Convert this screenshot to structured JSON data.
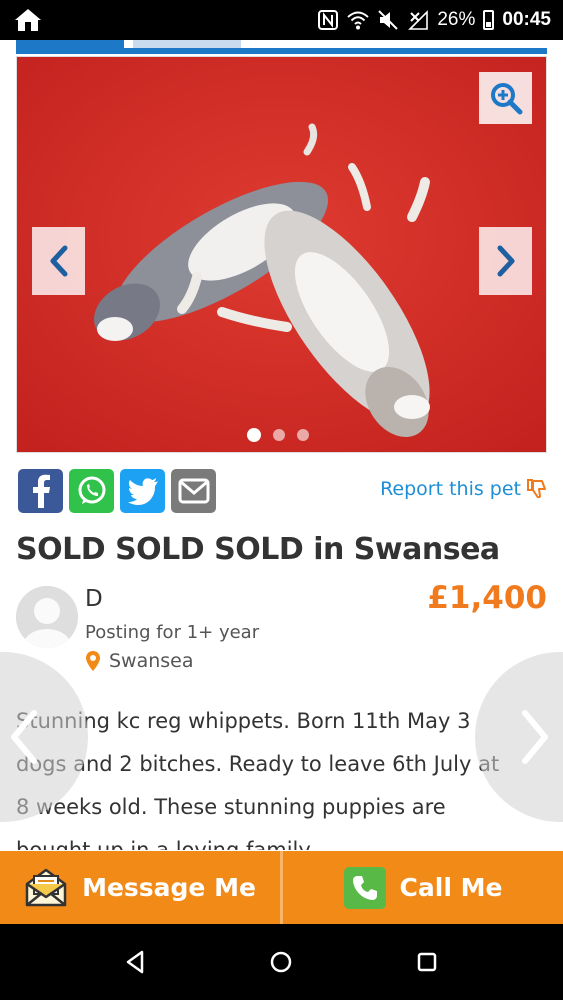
{
  "status_bar": {
    "battery_percent": "26%",
    "time": "00:45"
  },
  "gallery": {
    "total_images": 3,
    "current_index": 0
  },
  "share": {
    "report_label": "Report this pet"
  },
  "listing": {
    "title": "SOLD SOLD SOLD in Swansea",
    "seller_name": "D",
    "posting_for": "Posting for 1+ year",
    "location": "Swansea",
    "price": "£1,400",
    "description": "Stunning kc reg whippets. Born 11th May 3 dogs and 2 bitches. Ready to leave 6th July at 8 weeks old. These stunning puppies are bought up in a loving family"
  },
  "actions": {
    "message_label": "Message Me",
    "call_label": "Call Me"
  },
  "colors": {
    "accent_orange": "#f28a17",
    "price_orange": "#f07b1f",
    "link_blue": "#1e8fd6",
    "tab_blue": "#1e78c8"
  }
}
